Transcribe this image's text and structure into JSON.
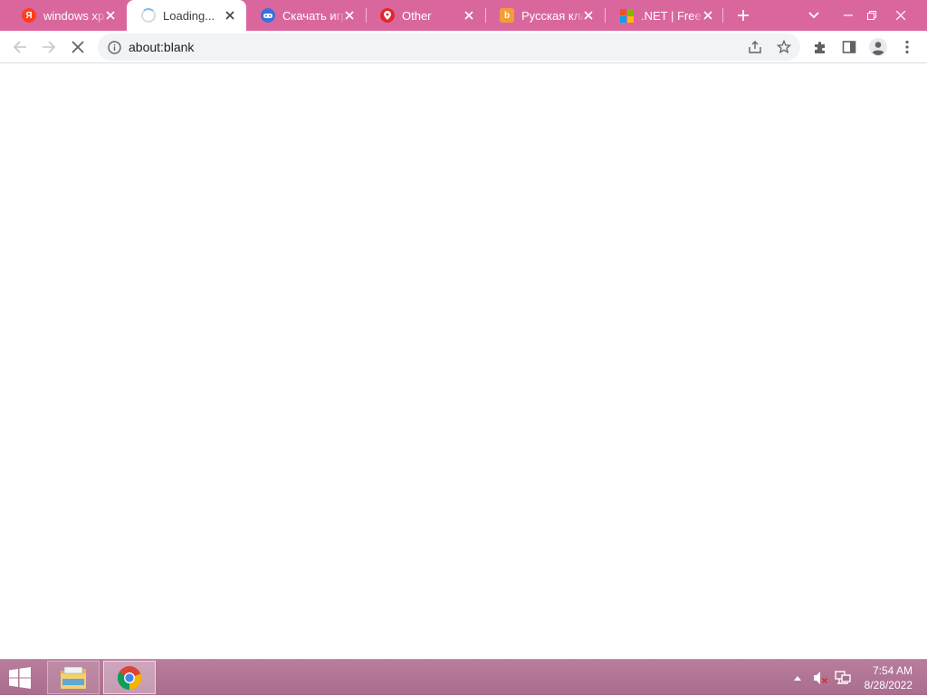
{
  "window": {
    "tabs": [
      {
        "title": "windows xp",
        "favicon": "yandex-icon",
        "color": "#fc3f1d",
        "glyph": "Я"
      },
      {
        "title": "Loading...",
        "favicon": "loading-spinner-icon",
        "active": true
      },
      {
        "title": "Скачать игр",
        "favicon": "gamepad-icon",
        "color": "#3b6fd8"
      },
      {
        "title": "Other",
        "favicon": "location-pin-icon",
        "color": "#e3262b"
      },
      {
        "title": "Русская кла",
        "favicon": "bing-icon",
        "color": "#f29e38"
      },
      {
        "title": ".NET | Free.",
        "favicon": "microsoft-icon"
      }
    ],
    "new_tab_icon": "plus-icon",
    "tab_search_icon": "chevron-down-icon"
  },
  "toolbar": {
    "url": "about:blank",
    "back_icon": "back-arrow-icon",
    "forward_icon": "forward-arrow-icon",
    "stop_icon": "close-icon"
  },
  "taskbar": {
    "time": "7:54 AM",
    "date": "8/28/2022",
    "apps": [
      "file-explorer-icon",
      "chrome-icon"
    ]
  },
  "colors": {
    "tabstrip": "#d9679e",
    "taskbar": "#b07494",
    "omnibox": "#f1f3f4"
  }
}
